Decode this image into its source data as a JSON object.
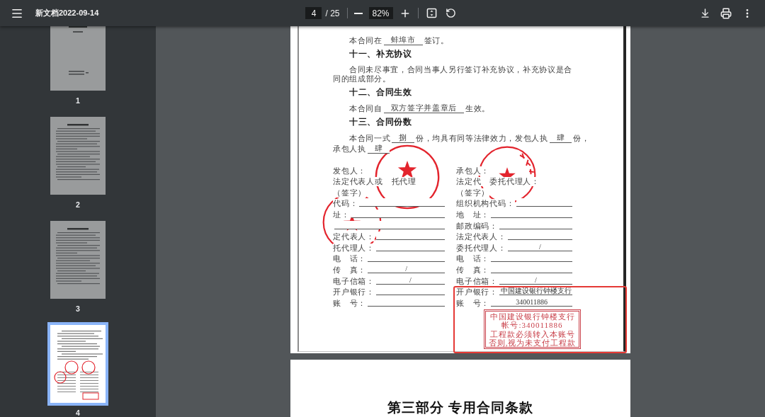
{
  "toolbar": {
    "title": "新文档2022-09-14",
    "page_input": {
      "value": "4"
    },
    "page_total": "/ 25",
    "zoom_input": {
      "value": "82%"
    }
  },
  "thumbnails": [
    {
      "label": "1",
      "kind": "cover",
      "selected": false
    },
    {
      "label": "2",
      "kind": "text",
      "selected": false
    },
    {
      "label": "3",
      "kind": "text",
      "selected": false
    },
    {
      "label": "4",
      "kind": "signature",
      "selected": true
    }
  ],
  "page": {
    "blocks": [
      {
        "kind": "fill",
        "parts": [
          {
            "kind": "text",
            "text": "本合同在"
          },
          {
            "kind": "blank",
            "text": "蚌埠市"
          },
          {
            "kind": "text",
            "text": "签订。"
          }
        ]
      },
      {
        "kind": "heading",
        "text": "十一、补充协议"
      },
      {
        "kind": "paragraph",
        "text": "合同未尽事宜，合同当事人另行签订补充协议，补充协议是合同的组成部分。"
      },
      {
        "kind": "heading",
        "text": "十二、合同生效"
      },
      {
        "kind": "fill",
        "parts": [
          {
            "kind": "text",
            "text": "本合同自"
          },
          {
            "kind": "blank",
            "text": "双方签字并盖章后"
          },
          {
            "kind": "text",
            "text": "生效。"
          }
        ]
      },
      {
        "kind": "heading",
        "text": "十三、合同份数"
      },
      {
        "kind": "fill",
        "parts": [
          {
            "kind": "text",
            "text": "本合同一式"
          },
          {
            "kind": "blank",
            "text": "捌"
          },
          {
            "kind": "text",
            "text": "份，均具有同等法律效力，发包人执"
          },
          {
            "kind": "blank",
            "text": "肆"
          },
          {
            "kind": "text",
            "text": "份，"
          }
        ]
      },
      {
        "kind": "fill_wrap",
        "parts": [
          {
            "kind": "text",
            "text": "承包人执"
          },
          {
            "kind": "blank",
            "text": "肆"
          }
        ]
      }
    ],
    "signature_rows": [
      {
        "left": {
          "kind": "label",
          "label": "发包人："
        },
        "right": {
          "kind": "label",
          "label": "承包人："
        }
      },
      {
        "left": {
          "kind": "label",
          "label": "法定代表人或　托代理"
        },
        "right": {
          "kind": "label",
          "label": "法定代　委托代理人："
        }
      },
      {
        "left": {
          "kind": "label",
          "label": "（签字）"
        },
        "right": {
          "kind": "label",
          "label": "（签字）"
        }
      },
      {
        "left": {
          "kind": "field",
          "label": "代码："
        },
        "right": {
          "kind": "field",
          "label": "组织机构代码："
        }
      },
      {
        "left": {
          "kind": "field",
          "label": "址："
        },
        "right": {
          "kind": "field",
          "label": "地　址："
        }
      },
      {
        "left": {
          "kind": "field"
        },
        "right": {
          "kind": "field",
          "label": "邮政编码："
        }
      },
      {
        "left": {
          "kind": "field",
          "label": "定代表人："
        },
        "right": {
          "kind": "field",
          "label": "法定代表人："
        }
      },
      {
        "left": {
          "kind": "field",
          "label": "托代理人："
        },
        "right": {
          "kind": "field",
          "label": "委托代理人：",
          "value": "/"
        }
      },
      {
        "left": {
          "kind": "field",
          "label": "电　话："
        },
        "right": {
          "kind": "field",
          "label": "电　话："
        }
      },
      {
        "left": {
          "kind": "field",
          "label": "传　真：",
          "value": "/"
        },
        "right": {
          "kind": "field",
          "label": "传　真："
        }
      },
      {
        "left": {
          "kind": "field",
          "label": "电子信箱：",
          "value": "/"
        },
        "right": {
          "kind": "field",
          "label": "电子信箱：",
          "value": "/"
        }
      },
      {
        "left": {
          "kind": "field",
          "label": "开户银行："
        },
        "right": {
          "kind": "field",
          "label": "开户银行：",
          "value": "中国建设银行钟楼支行"
        }
      },
      {
        "left": {
          "kind": "field",
          "label": "账　号："
        },
        "right": {
          "kind": "field",
          "label": "账　号：",
          "value": "340011886"
        }
      }
    ],
    "bank_seal": {
      "lines": [
        "中国建设银行钟楼支行",
        "帐号:340011886",
        "工程款必须转入本账号",
        "否则,视为未支付工程款"
      ]
    }
  },
  "next_page": {
    "heading": "第三部分 专用合同条款"
  }
}
